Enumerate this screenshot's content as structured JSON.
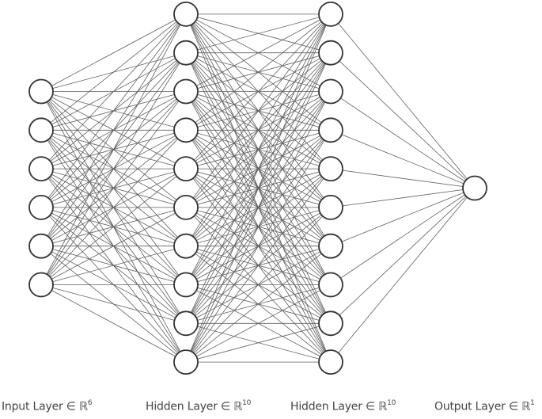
{
  "diagram": {
    "type": "feedforward-neural-network",
    "layers": [
      {
        "label_text": "Input Layer ∈ ℝ",
        "dim": "6",
        "nodes": 6
      },
      {
        "label_text": "Hidden Layer ∈ ℝ",
        "dim": "10",
        "nodes": 10
      },
      {
        "label_text": "Hidden Layer ∈ ℝ",
        "dim": "10",
        "nodes": 10
      },
      {
        "label_text": "Output Layer ∈ ℝ",
        "dim": "1",
        "nodes": 1
      }
    ],
    "connectivity": "fully-connected",
    "colors": {
      "edge": "#5f5f5f",
      "node_stroke": "#333333",
      "node_fill": "#ffffff",
      "label": "#444444"
    }
  }
}
